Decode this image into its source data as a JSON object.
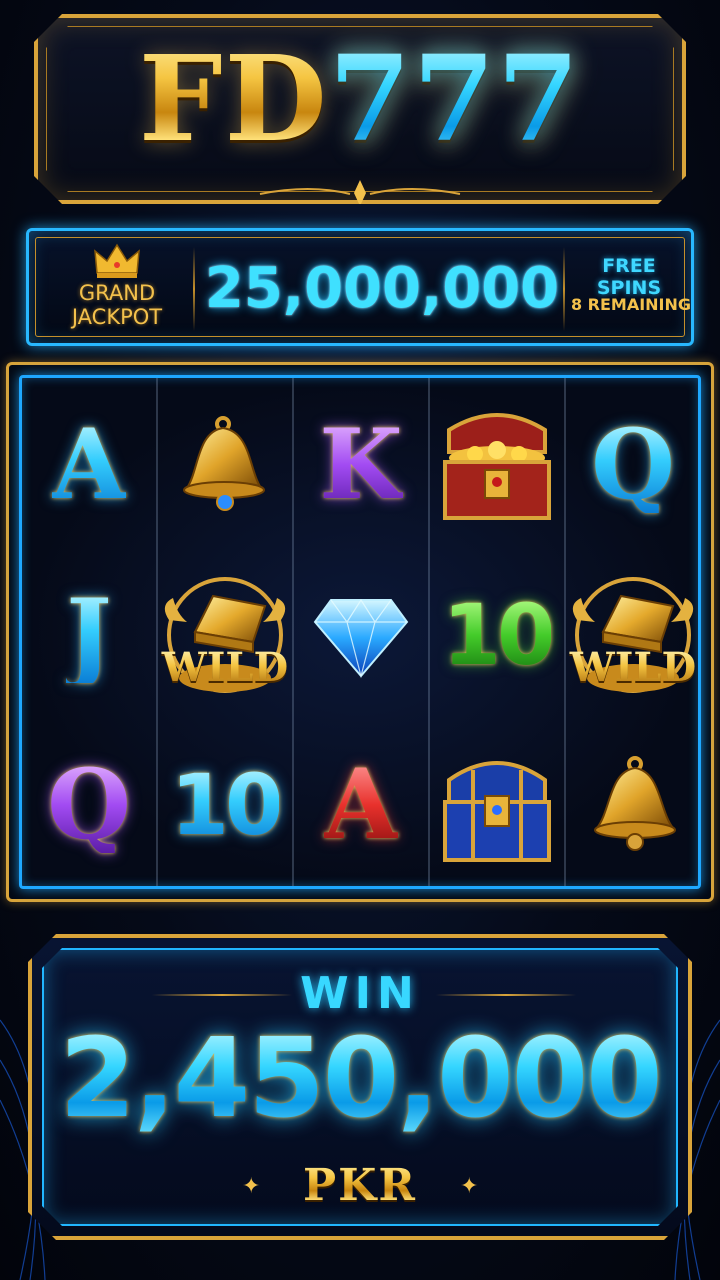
{
  "header": {
    "title_part1": "FD",
    "title_part2": "777"
  },
  "jackpot": {
    "label_line1": "GRAND",
    "label_line2": "JACKPOT",
    "amount": "25,000,000",
    "free_spins_label": "FREE SPINS",
    "remaining_label": "8 REMAINING"
  },
  "reels": [
    [
      {
        "symbol": "A",
        "type": "letter",
        "color": "blue"
      },
      {
        "symbol": "J",
        "type": "letter",
        "color": "blue"
      },
      {
        "symbol": "Q",
        "type": "letter",
        "color": "purple"
      }
    ],
    [
      {
        "symbol": "bell",
        "type": "icon"
      },
      {
        "symbol": "WILD",
        "type": "wild"
      },
      {
        "symbol": "10",
        "type": "number",
        "color": "blue"
      }
    ],
    [
      {
        "symbol": "K",
        "type": "letter",
        "color": "purple"
      },
      {
        "symbol": "diamond",
        "type": "icon"
      },
      {
        "symbol": "A",
        "type": "letter",
        "color": "red"
      }
    ],
    [
      {
        "symbol": "treasure-chest-red",
        "type": "icon"
      },
      {
        "symbol": "10",
        "type": "number",
        "color": "green"
      },
      {
        "symbol": "treasure-chest-blue",
        "type": "icon"
      }
    ],
    [
      {
        "symbol": "Q",
        "type": "letter",
        "color": "blue"
      },
      {
        "symbol": "WILD",
        "type": "wild"
      },
      {
        "symbol": "bell",
        "type": "icon"
      }
    ]
  ],
  "win": {
    "label": "WIN",
    "amount": "2,450,000",
    "currency": "PKR"
  },
  "colors": {
    "gold": "#d9a43a",
    "cyan": "#28b8ff"
  }
}
